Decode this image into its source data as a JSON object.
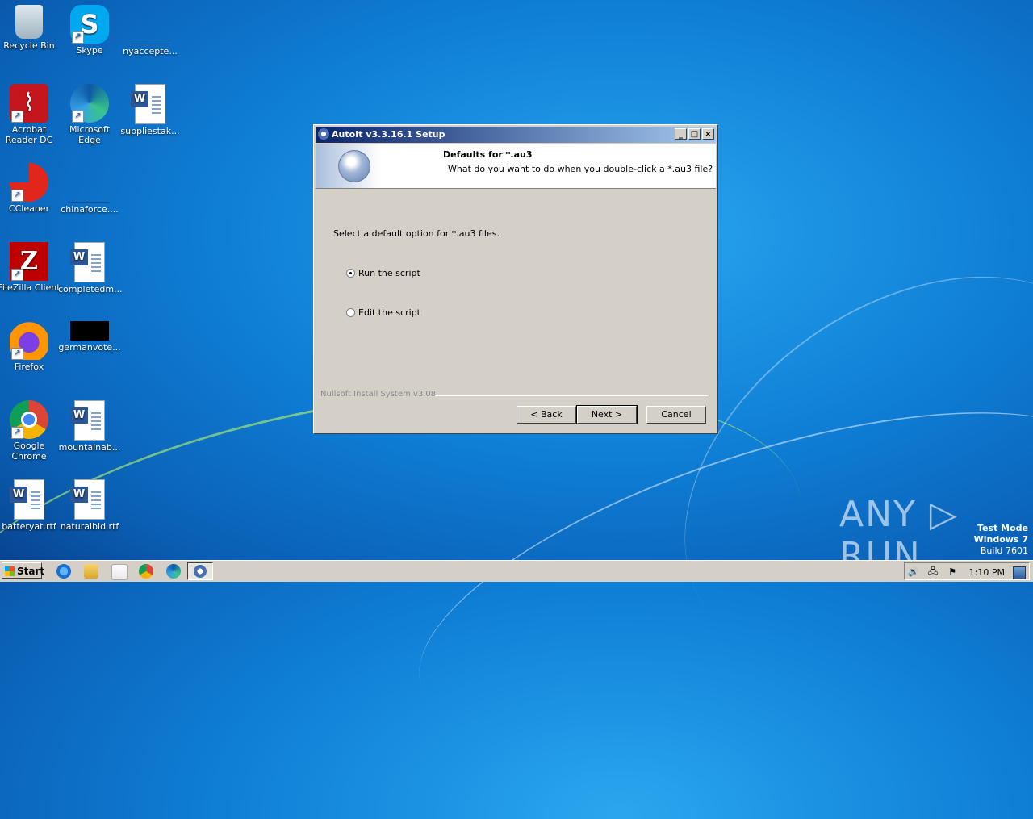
{
  "desktop": {
    "icons": [
      {
        "label": "Recycle Bin"
      },
      {
        "label": "Skype"
      },
      {
        "label": "nyaccepte..."
      },
      {
        "label": "Acrobat Reader DC"
      },
      {
        "label": "Microsoft Edge"
      },
      {
        "label": "suppliestak..."
      },
      {
        "label": "CCleaner"
      },
      {
        "label": "chinaforce...."
      },
      {
        "label": "FileZilla Client"
      },
      {
        "label": "completedm..."
      },
      {
        "label": "Firefox"
      },
      {
        "label": "germanvote..."
      },
      {
        "label": "Google Chrome"
      },
      {
        "label": "mountainab..."
      },
      {
        "label": "batteryat.rtf"
      },
      {
        "label": "naturalbid.rtf"
      }
    ]
  },
  "dialog": {
    "title": "AutoIt v3.3.16.1 Setup",
    "header_title": "Defaults for *.au3",
    "header_subtitle": "What do you want to do when you double-click a *.au3 file?",
    "prompt": "Select a default option for *.au3 files.",
    "options": [
      {
        "label": "Run the script",
        "selected": true
      },
      {
        "label": "Edit the script",
        "selected": false
      }
    ],
    "branding": "Nullsoft Install System v3.08",
    "buttons": {
      "back": "< Back",
      "next": "Next >",
      "cancel": "Cancel"
    },
    "title_buttons": {
      "minimize": "_",
      "maximize": "□",
      "close": "×"
    }
  },
  "watermark": {
    "brand": "ANY ▷ RUN",
    "line1": "Test Mode",
    "line2": "Windows 7",
    "line3": "Build 7601"
  },
  "taskbar": {
    "start_label": "Start",
    "clock": "1:10 PM",
    "tray_glyphs": {
      "volume": "🔊",
      "network": "🖧",
      "flag": "⚑"
    }
  },
  "colors": {
    "title_gradient_start": "#0a246a",
    "title_gradient_end": "#a6caf0",
    "desktop_blue": "#0f7fd6"
  }
}
